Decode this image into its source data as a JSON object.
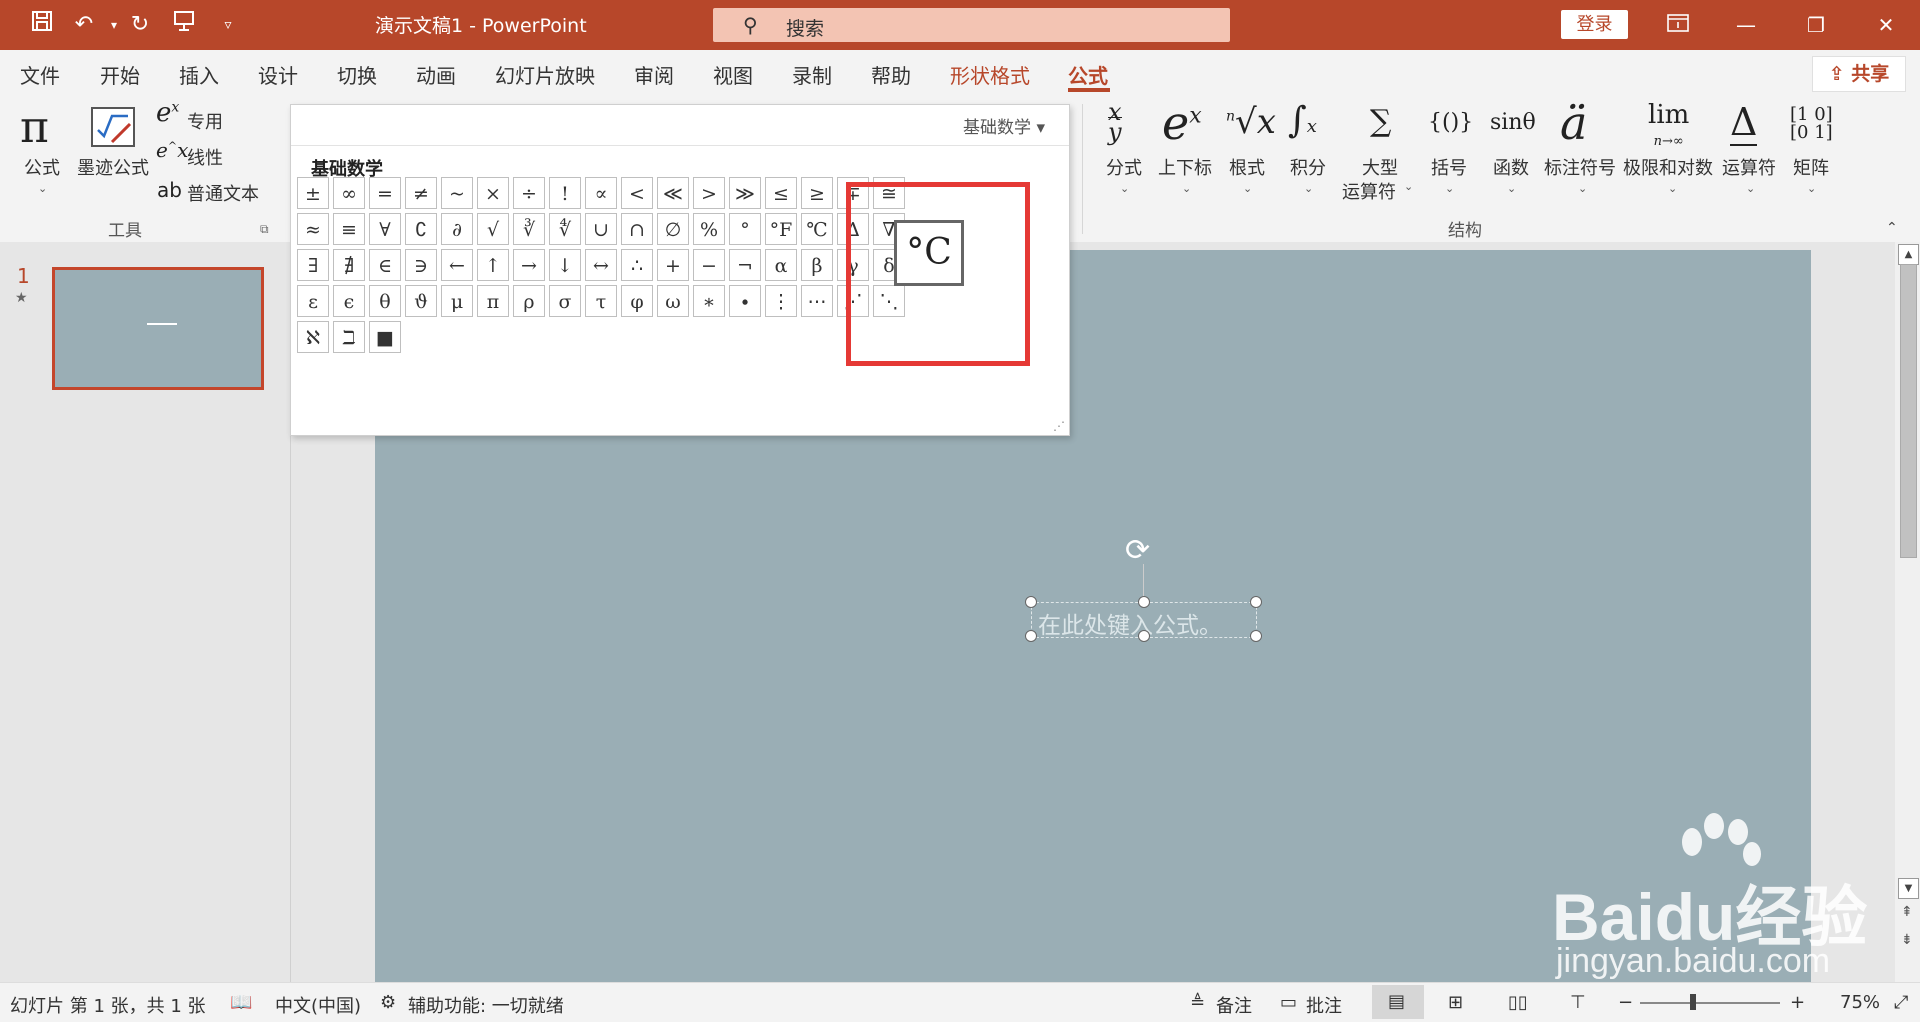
{
  "titlebar": {
    "doc_title": "演示文稿1  -  PowerPoint",
    "search_placeholder": "搜索",
    "login_label": "登录"
  },
  "tabs": [
    {
      "label": "文件"
    },
    {
      "label": "开始"
    },
    {
      "label": "插入"
    },
    {
      "label": "设计"
    },
    {
      "label": "切换"
    },
    {
      "label": "动画"
    },
    {
      "label": "幻灯片放映"
    },
    {
      "label": "审阅"
    },
    {
      "label": "视图"
    },
    {
      "label": "录制"
    },
    {
      "label": "帮助"
    },
    {
      "label": "形状格式"
    },
    {
      "label": "公式"
    }
  ],
  "share_label": "共享",
  "ribbon": {
    "tools": {
      "equation": "公式",
      "ink_equation": "墨迹公式",
      "professional": "专用",
      "linear": "线性",
      "normal_text": "普通文本",
      "group_label": "工具"
    },
    "structures": {
      "items": [
        {
          "label": "分式"
        },
        {
          "label": "上下标"
        },
        {
          "label": "根式"
        },
        {
          "label": "积分"
        },
        {
          "label": "大型"
        },
        {
          "label": "括号"
        },
        {
          "label": "函数"
        },
        {
          "label": "标注符号"
        },
        {
          "label": "极限和对数"
        },
        {
          "label": "运算符"
        },
        {
          "label": "矩阵"
        }
      ],
      "large_operator_line2": "运算符",
      "group_label": "结构"
    }
  },
  "gallery": {
    "dropdown_label": "基础数学",
    "section_title": "基础数学",
    "rows": [
      [
        "±",
        "∞",
        "=",
        "≠",
        "~",
        "×",
        "÷",
        "!",
        "∝",
        "<",
        "≪",
        ">",
        "≫",
        "≤",
        "≥",
        "∓",
        "≅"
      ],
      [
        "≈",
        "≡",
        "∀",
        "∁",
        "∂",
        "√",
        "∛",
        "∜",
        "∪",
        "∩",
        "∅",
        "%",
        "°",
        "°F",
        "℃",
        "∆",
        "∇"
      ],
      [
        "∃",
        "∄",
        "∈",
        "∋",
        "←",
        "↑",
        "→",
        "↓",
        "↔",
        "∴",
        "+",
        "−",
        "¬",
        "α",
        "β",
        "γ",
        "δ"
      ],
      [
        "ε",
        "ϵ",
        "θ",
        "ϑ",
        "μ",
        "π",
        "ρ",
        "σ",
        "τ",
        "φ",
        "ω",
        "∗",
        "∙",
        "⋮",
        "⋯",
        "⋰",
        "⋱"
      ],
      [
        "ℵ",
        "ℶ",
        "■"
      ]
    ],
    "tooltip_symbol": "°C"
  },
  "thumbnail": {
    "number": "1"
  },
  "slide": {
    "equation_placeholder": "在此处键入公式。"
  },
  "watermark": {
    "brand": "Baidu经验",
    "url": "jingyan.baidu.com"
  },
  "statusbar": {
    "slide_info": "幻灯片 第 1 张，共 1 张",
    "language": "中文(中国)",
    "accessibility": "辅助功能: 一切就绪",
    "notes": "备注",
    "comments": "批注",
    "zoom_minus": "−",
    "zoom_plus": "+",
    "zoom": "75%"
  }
}
